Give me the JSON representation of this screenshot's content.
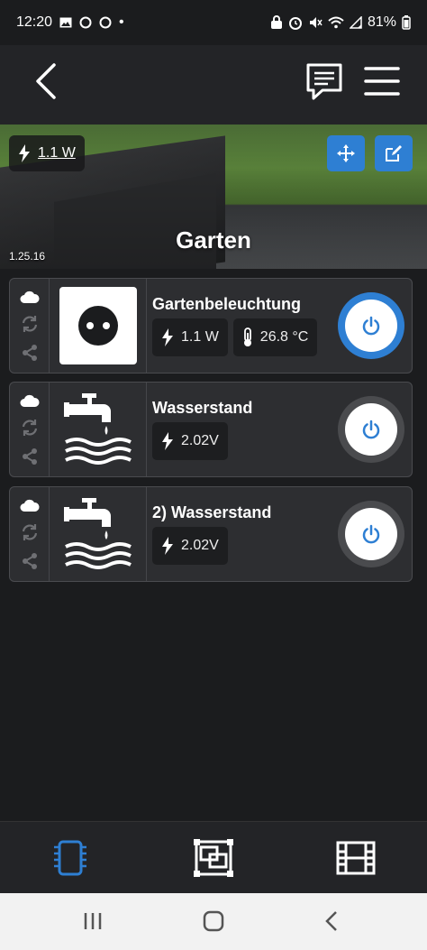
{
  "status_bar": {
    "time": "12:20",
    "battery": "81%",
    "dot": "•"
  },
  "header": {
    "back_icon": "chevron-left-icon",
    "message_icon": "chat-icon",
    "menu_icon": "hamburger-icon"
  },
  "hero": {
    "power": "1.1 W",
    "title": "Garten",
    "version": "1.25.16"
  },
  "devices": [
    {
      "name": "Gartenbeleuchtung",
      "thumb": "socket-icon",
      "chips": [
        {
          "icon": "bolt",
          "text": "1.1 W"
        },
        {
          "icon": "thermometer",
          "text": "26.8 °C"
        }
      ],
      "state": "on"
    },
    {
      "name": "Wasserstand",
      "thumb": "faucet-icon",
      "chips": [
        {
          "icon": "bolt",
          "text": "2.02V"
        }
      ],
      "state": "off"
    },
    {
      "name": "2) Wasserstand",
      "thumb": "faucet-icon",
      "chips": [
        {
          "icon": "bolt",
          "text": "2.02V"
        }
      ],
      "state": "off"
    }
  ],
  "colors": {
    "accent": "#2e7fd3",
    "background": "#1b1c1e",
    "card": "#2d2e31"
  }
}
